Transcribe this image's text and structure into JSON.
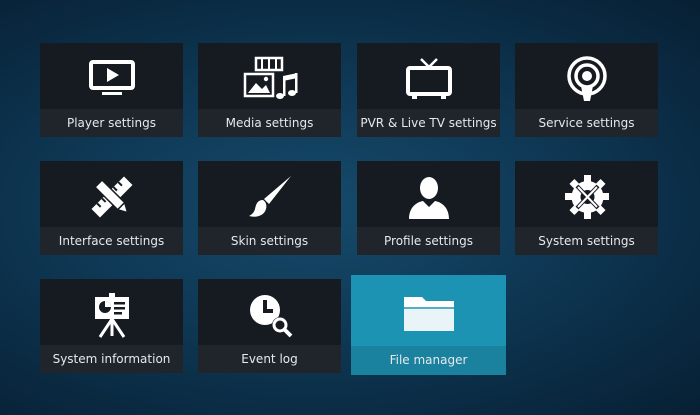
{
  "settings_menu": {
    "tiles": [
      {
        "label": "Player settings",
        "icon": "monitor-play-icon"
      },
      {
        "label": "Media settings",
        "icon": "media-icon"
      },
      {
        "label": "PVR & Live TV settings",
        "icon": "tv-icon"
      },
      {
        "label": "Service settings",
        "icon": "podcast-icon"
      },
      {
        "label": "Interface settings",
        "icon": "pencil-ruler-icon"
      },
      {
        "label": "Skin settings",
        "icon": "paintbrush-icon"
      },
      {
        "label": "Profile settings",
        "icon": "user-icon"
      },
      {
        "label": "System settings",
        "icon": "gear-tools-icon"
      },
      {
        "label": "System information",
        "icon": "presentation-icon"
      },
      {
        "label": "Event log",
        "icon": "clock-search-icon"
      },
      {
        "label": "File manager",
        "icon": "folder-icon",
        "focused": true
      }
    ]
  },
  "colors": {
    "background": "#0f3a57",
    "tile": "#161b21",
    "tile_label": "#1f252b",
    "focused_tile": "#1d93b3",
    "text": "#e6e9ec"
  }
}
